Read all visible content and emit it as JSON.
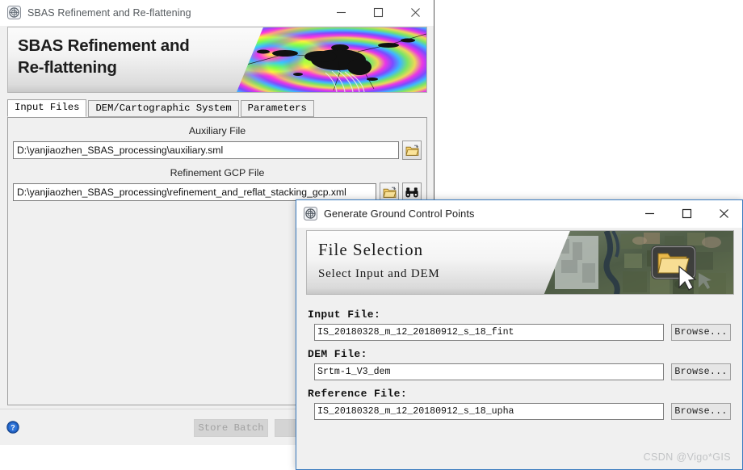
{
  "background_window": {
    "title": "SBAS Refinement and Re-flattening",
    "icon": "app-globe-icon",
    "controls": {
      "minimize": "minimize-icon",
      "maximize": "maximize-icon",
      "close": "close-icon"
    },
    "banner": {
      "title_line1": "SBAS Refinement and",
      "title_line2": "Re-flattening",
      "image": "interferogram-fringe-image"
    },
    "tabs": [
      {
        "label": "Input Files",
        "active": true
      },
      {
        "label": "DEM/Cartographic System",
        "active": false
      },
      {
        "label": "Parameters",
        "active": false
      }
    ],
    "fields": [
      {
        "label": "Auxiliary File",
        "value": "D:\\yanjiaozhen_SBAS_processing\\auxiliary.sml",
        "placeholder": "",
        "buttons": [
          "folder-open-icon"
        ]
      },
      {
        "label": "Refinement GCP File",
        "value": "D:\\yanjiaozhen_SBAS_processing\\refinement_and_reflat_stacking_gcp.xml",
        "placeholder": "",
        "buttons": [
          "folder-open-icon",
          "binoculars-icon"
        ]
      }
    ],
    "bottom": {
      "help_icon": "help-question-icon",
      "store_batch_label": "Store Batch",
      "second_button_label": ""
    }
  },
  "foreground_dialog": {
    "title": "Generate Ground Control Points",
    "icon": "app-globe-icon",
    "controls": {
      "minimize": "minimize-icon",
      "maximize": "maximize-icon",
      "close": "close-icon"
    },
    "banner": {
      "title": "File Selection",
      "subtitle": "Select Input and DEM",
      "image": "satellite-aerial-image",
      "overlay_icon": "folder-open-large-icon",
      "cursor_icon": "mouse-pointer-icon"
    },
    "fields": [
      {
        "label": "Input File:",
        "value": "IS_20180328_m_12_20180912_s_18_fint",
        "placeholder": "",
        "browse_label": "Browse..."
      },
      {
        "label": "DEM File:",
        "value": "Srtm-1_V3_dem",
        "placeholder": "",
        "browse_label": "Browse..."
      },
      {
        "label": "Reference File:",
        "value": "IS_20180328_m_12_20180912_s_18_upha",
        "placeholder": "",
        "browse_label": "Browse..."
      }
    ],
    "watermark": "CSDN @Vigo*GIS"
  },
  "colors": {
    "dialog_border": "#3a7bbf",
    "panel_bg": "#f0f0f0",
    "input_bg": "#ffffff",
    "help_blue": "#1f5fbf",
    "disabled_text": "#a2a2a2"
  }
}
